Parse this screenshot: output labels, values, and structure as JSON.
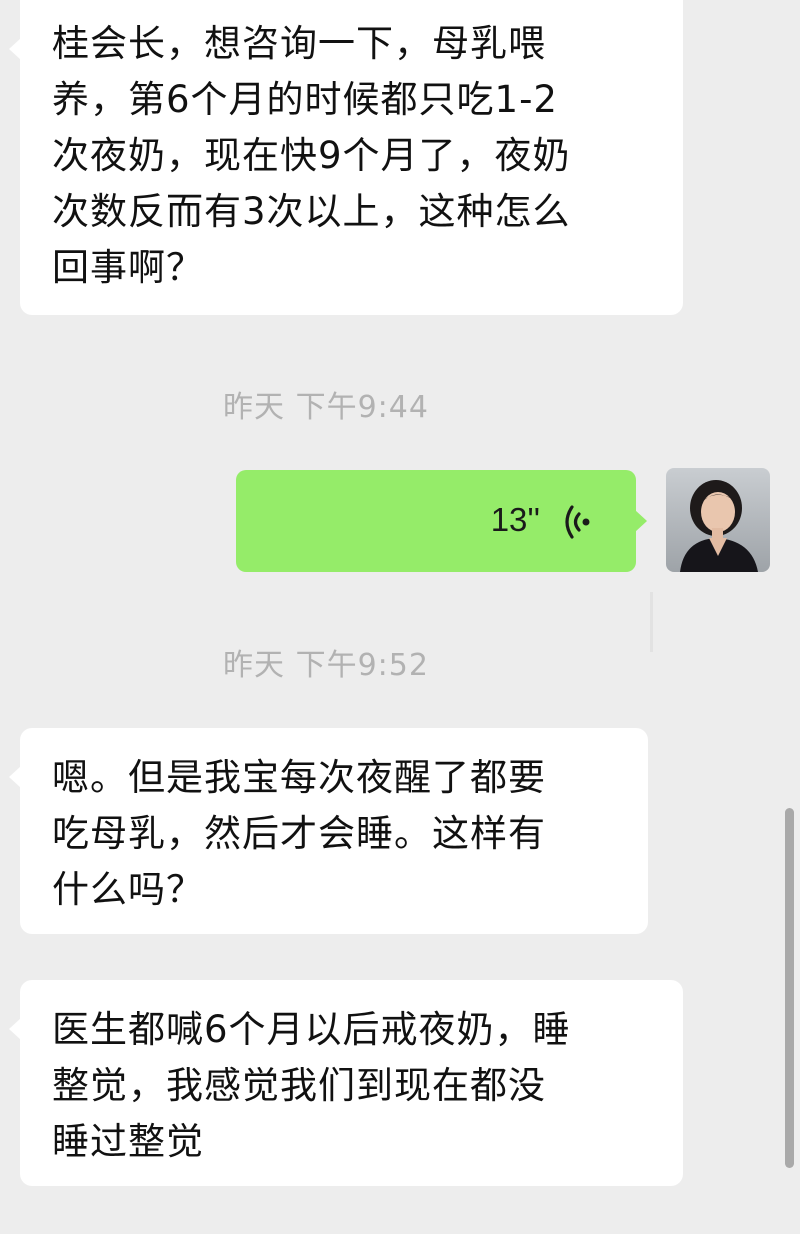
{
  "messages": [
    {
      "text": "桂会长，想咨询一下，母乳喂\n养，第6个月的时候都只吃1-2\n次夜奶，现在快9个月了，夜奶\n次数反而有3次以上，这种怎么\n回事啊？"
    },
    {
      "text": "嗯。但是我宝每次夜醒了都要\n吃母乳，然后才会睡。这样有\n什么吗？"
    },
    {
      "text": "医生都喊6个月以后戒夜奶，睡\n整觉，我感觉我们到现在都没\n睡过整觉"
    }
  ],
  "timestamps": [
    "昨天 下午9:44",
    "昨天 下午9:52"
  ],
  "voice_message": {
    "duration": "13''",
    "icon": "voice-wave-icon"
  },
  "avatar": {
    "icon": "user-avatar"
  },
  "colors": {
    "background": "#ededed",
    "incoming_bubble": "#ffffff",
    "outgoing_bubble": "#95ec69",
    "timestamp": "#b2b2b2"
  }
}
